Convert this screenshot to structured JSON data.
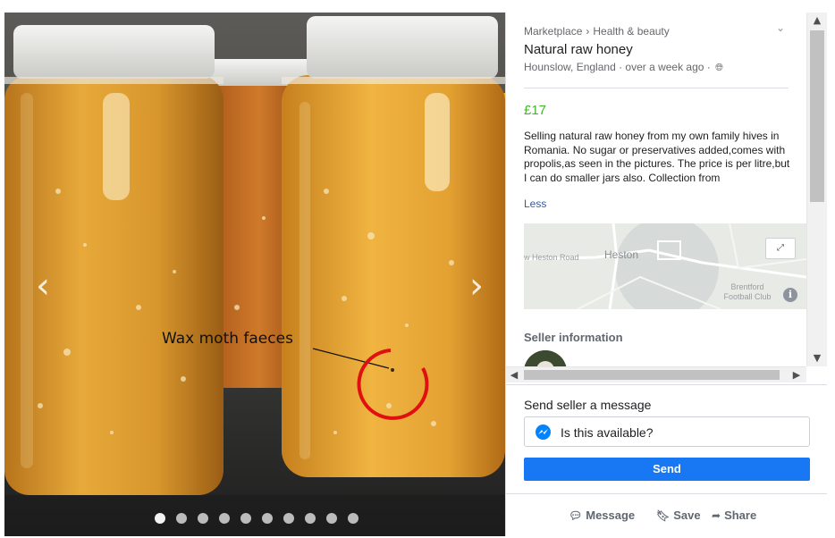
{
  "viewer": {
    "photo_alt": "Jars of honey",
    "annotation": "Wax moth faeces",
    "photo_count": 10,
    "active_photo": 1,
    "icons": {
      "prev": "chevron-left-icon",
      "next": "chevron-right-icon"
    }
  },
  "listing": {
    "breadcrumb": [
      "Marketplace",
      "Health & beauty"
    ],
    "breadcrumb_separator": "›",
    "title": "Natural raw honey",
    "location": "Hounslow, England · over a week ago ·",
    "price": "£17",
    "description": "Selling natural raw honey from my own family hives in Romania. No sugar or preservatives added,comes with propolis,as seen in the pictures. The price is per litre,but I can do smaller jars also. Collection from",
    "less_label": "Less",
    "price_color": "#42b72a"
  },
  "map": {
    "place_label": "Heston",
    "road_label": "w Heston Road",
    "landmark_label": "Brentford Football Club"
  },
  "seller": {
    "heading": "Seller information"
  },
  "message": {
    "heading": "Send seller a message",
    "input_value": "Is this available?",
    "send_label": "Send",
    "send_color": "#1877f2"
  },
  "actions": {
    "message_label": "Message",
    "save_label": "Save",
    "share_label": "Share"
  }
}
